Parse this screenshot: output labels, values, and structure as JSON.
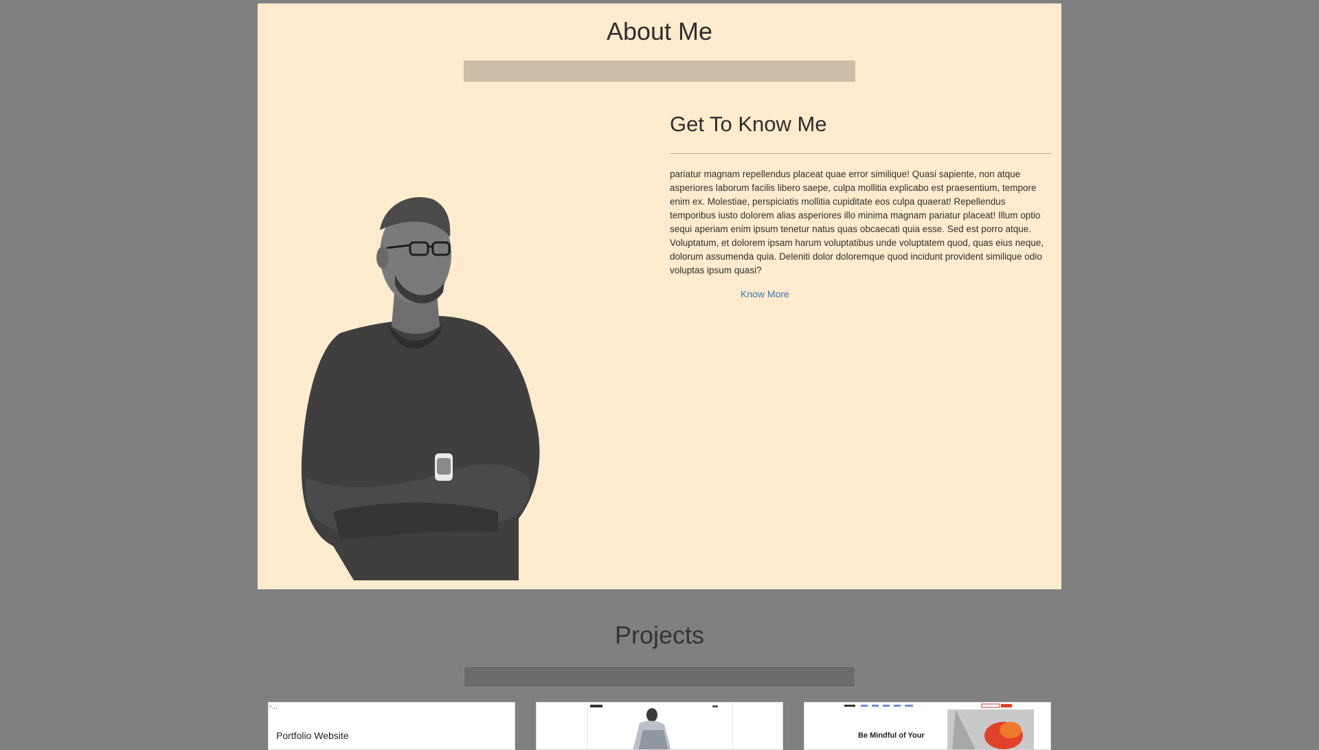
{
  "about": {
    "title": "About Me",
    "heading": "Get To Know Me",
    "body": "pariatur magnam repellendus placeat quae error similique! Quasi sapiente, non atque asperiores laborum facilis libero saepe, culpa mollitia explicabo est praesentium, tempore enim ex. Molestiae, perspiciatis mollitia cupiditate eos culpa quaerat! Repellendus temporibus iusto dolorem alias asperiores illo minima magnam pariatur placeat! Illum optio sequi aperiam enim ipsum tenetur natus quas obcaecati quia esse. Sed est porro atque. Voluptatum, et dolorem ipsam harum voluptatibus unde voluptatem quod, quas eius neque, dolorum assumenda quia. Deleniti dolor doloremque quod incidunt provident similique odio voluptas ipsum quasi?",
    "cta_label": "Know More"
  },
  "projects": {
    "title": "Projects",
    "cards": [
      {
        "title": "Portfolio Website",
        "image_alt": "..."
      },
      {
        "title": ""
      },
      {
        "title": "",
        "thumb_text": "Be Mindful of Your"
      }
    ]
  },
  "colors": {
    "page_bg": "#808080",
    "about_bg": "#ffebcd",
    "accent_bar": "#cdbca8",
    "link": "#3877b5"
  }
}
